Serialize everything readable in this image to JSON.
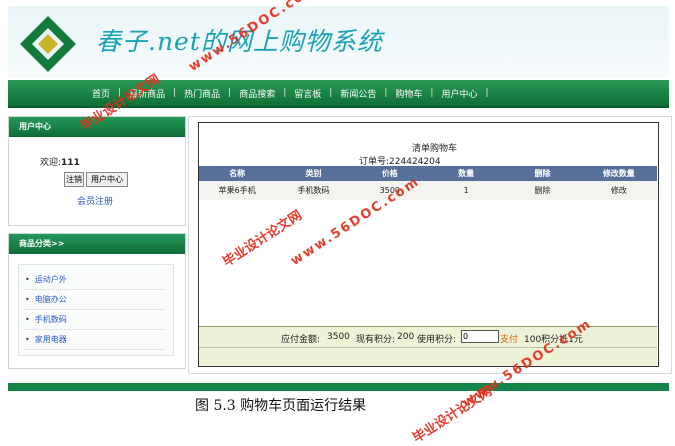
{
  "header": {
    "title": "春子.net的网上购物系统"
  },
  "nav": {
    "items": [
      "首页",
      "最新商品",
      "热门商品",
      "商品搜索",
      "留言板",
      "新闻公告",
      "购物车",
      "用户中心"
    ],
    "separator": "|"
  },
  "user_panel": {
    "title": "用户中心",
    "welcome_label": "欢迎:",
    "username": "111",
    "logout_label": "注销",
    "user_center_label": "用户中心",
    "register_label": "会员注册"
  },
  "category_panel": {
    "title": "商品分类>>",
    "items": [
      "运动户外",
      "电脑办公",
      "手机数码",
      "家用电器"
    ]
  },
  "cart": {
    "title": "清单购物车",
    "order_label": "订单号:",
    "order_number": "224424204",
    "columns": [
      "名称",
      "类别",
      "价格",
      "数量",
      "删除",
      "修改数量"
    ],
    "rows": [
      {
        "name": "苹果6手机",
        "category": "手机数码",
        "price": "3500",
        "qty": "1",
        "delete": "删除",
        "modify": "修改"
      }
    ],
    "totals": {
      "amount_label": "应付金额:",
      "amount": "3500",
      "points_label": "现有积分:",
      "points": "200",
      "use_points_label": "使用积分:",
      "use_points_value": "0",
      "pay_label": "支付",
      "rule": "100积分抵1元"
    }
  },
  "caption": "图  5.3 购物车页面运行结果",
  "watermarks": {
    "cn": "毕业设计论文网",
    "url": "www.56DOC.com"
  },
  "colors": {
    "nav_green": "#0e6e34",
    "table_header": "#56709a",
    "title_teal": "#18a3b5",
    "pay_orange": "#e06010"
  }
}
